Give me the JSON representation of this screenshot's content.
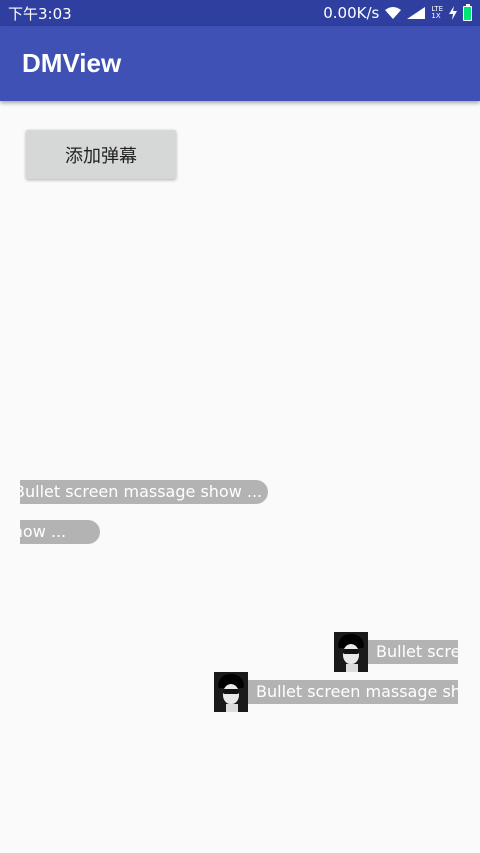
{
  "status_bar": {
    "time": "下午3:03",
    "network_speed": "0.00K/s",
    "lte_top": "LTE",
    "lte_bottom": "1X",
    "icons": [
      "wifi-icon",
      "signal-icon",
      "charging-icon",
      "battery-icon"
    ],
    "background": "#2f3f9f"
  },
  "app_bar": {
    "title": "DMView",
    "background": "#3f51b5"
  },
  "actions": {
    "add_danmaku_label": "添加弹幕"
  },
  "danmaku": {
    "items": [
      {
        "text": "Bullet screen massage show ..."
      },
      {
        "text": "Bullet screen massage show ..."
      },
      {
        "text": "Bullet screen massage show ..."
      },
      {
        "text": "Bullet screen massage show ..."
      }
    ],
    "bubble_color": "#b3b3b3",
    "text_color": "#ffffff"
  }
}
